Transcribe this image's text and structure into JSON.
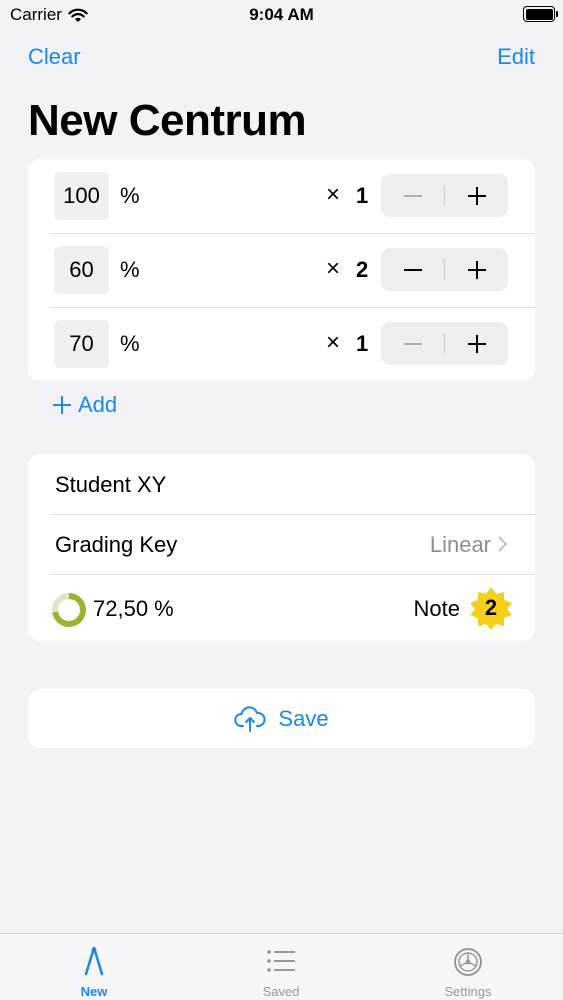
{
  "status": {
    "carrier": "Carrier",
    "time": "9:04 AM"
  },
  "nav": {
    "left": "Clear",
    "right": "Edit"
  },
  "title": "New Centrum",
  "grades": [
    {
      "value": "100",
      "unit": "%",
      "times": "×",
      "weight": "1"
    },
    {
      "value": "60",
      "unit": "%",
      "times": "×",
      "weight": "2"
    },
    {
      "value": "70",
      "unit": "%",
      "times": "×",
      "weight": "1"
    }
  ],
  "add_label": "Add",
  "info": {
    "student": "Student XY",
    "grading_key_label": "Grading Key",
    "grading_key_value": "Linear",
    "average": "72,50 %",
    "average_fraction": 0.725,
    "note_label": "Note",
    "note_value": "2"
  },
  "save_label": "Save",
  "tabs": [
    {
      "label": "New",
      "icon": "compass-icon"
    },
    {
      "label": "Saved",
      "icon": "list-icon"
    },
    {
      "label": "Settings",
      "icon": "gear-icon"
    }
  ],
  "colors": {
    "accent": "#1a8ae5",
    "ring": "#9bb52f",
    "badge": "#f6cf1a"
  }
}
